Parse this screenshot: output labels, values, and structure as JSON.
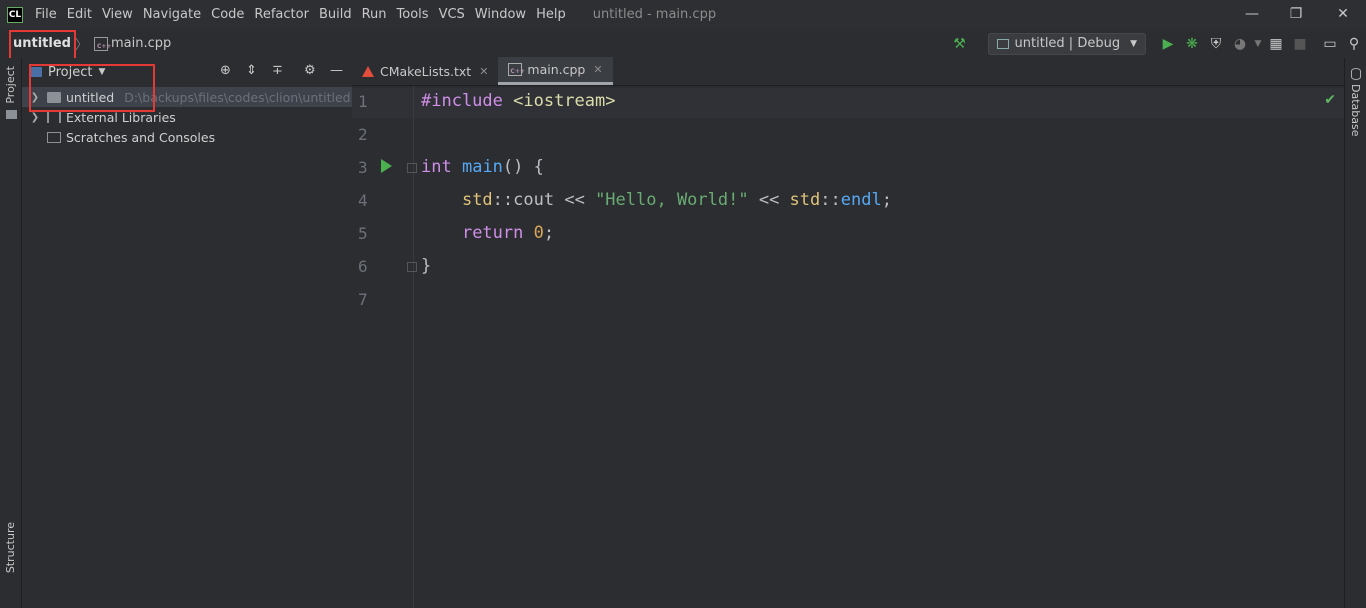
{
  "app": {
    "logo": "CL",
    "window_title": "untitled - main.cpp"
  },
  "menu": [
    "File",
    "Edit",
    "View",
    "Navigate",
    "Code",
    "Refactor",
    "Build",
    "Run",
    "Tools",
    "VCS",
    "Window",
    "Help"
  ],
  "navbar": {
    "project": "untitled",
    "separator": "〉",
    "file": "main.cpp"
  },
  "toolbar": {
    "run_config": "untitled | Debug"
  },
  "left_stripe": {
    "project_label": "Project",
    "structure_label": "Structure"
  },
  "right_stripe": {
    "database_label": "Database"
  },
  "project_panel": {
    "title": "Project",
    "tree": [
      {
        "label": "untitled",
        "path": "D:\\backups\\files\\codes\\clion\\untitled"
      },
      {
        "label": "External Libraries"
      },
      {
        "label": "Scratches and Consoles"
      }
    ]
  },
  "editor": {
    "tabs": [
      {
        "label": "CMakeLists.txt",
        "active": false
      },
      {
        "label": "main.cpp",
        "active": true
      }
    ],
    "line_numbers": [
      "1",
      "2",
      "3",
      "4",
      "5",
      "6",
      "7"
    ],
    "code": {
      "l1_directive": "#include",
      "l1_header": " <iostream>",
      "l3_type": "int",
      "l3_fn": "main",
      "l3_rest": "() {",
      "l4_ns1": "std",
      "l4_sep1": "::",
      "l4_cout": "cout",
      "l4_op1": " << ",
      "l4_str": "\"Hello, World!\"",
      "l4_op2": " << ",
      "l4_ns2": "std",
      "l4_sep2": "::",
      "l4_endl": "endl",
      "l4_semi": ";",
      "l5_kw": "return",
      "l5_num": "0",
      "l5_semi": ";",
      "l6": "}"
    }
  },
  "colors": {
    "highlight_box": "#e53935",
    "run_green": "#4caf50"
  }
}
